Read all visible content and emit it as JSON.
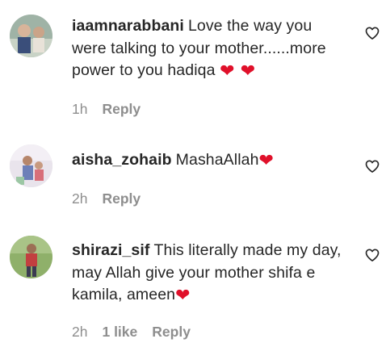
{
  "comments": [
    {
      "username": "iaamnarabbani",
      "text": "Love the way you were talking to your mother......more power to you hadiqa",
      "emoji": "❤ ❤",
      "time": "1h",
      "likes": "",
      "reply_label": "Reply"
    },
    {
      "username": "aisha_zohaib",
      "text": "MashaAllah",
      "emoji": "❤",
      "time": "2h",
      "likes": "",
      "reply_label": "Reply"
    },
    {
      "username": "shirazi_sif",
      "text": "This literally made my day, may Allah give your mother shifa e kamila, ameen",
      "emoji": "❤",
      "time": "2h",
      "likes": "1 like",
      "reply_label": "Reply"
    }
  ],
  "icons": {
    "like": "heart-outline-icon"
  },
  "colors": {
    "primary_text": "#262626",
    "secondary_text": "#8e8e8e",
    "heart_emoji": "#e0102a"
  }
}
